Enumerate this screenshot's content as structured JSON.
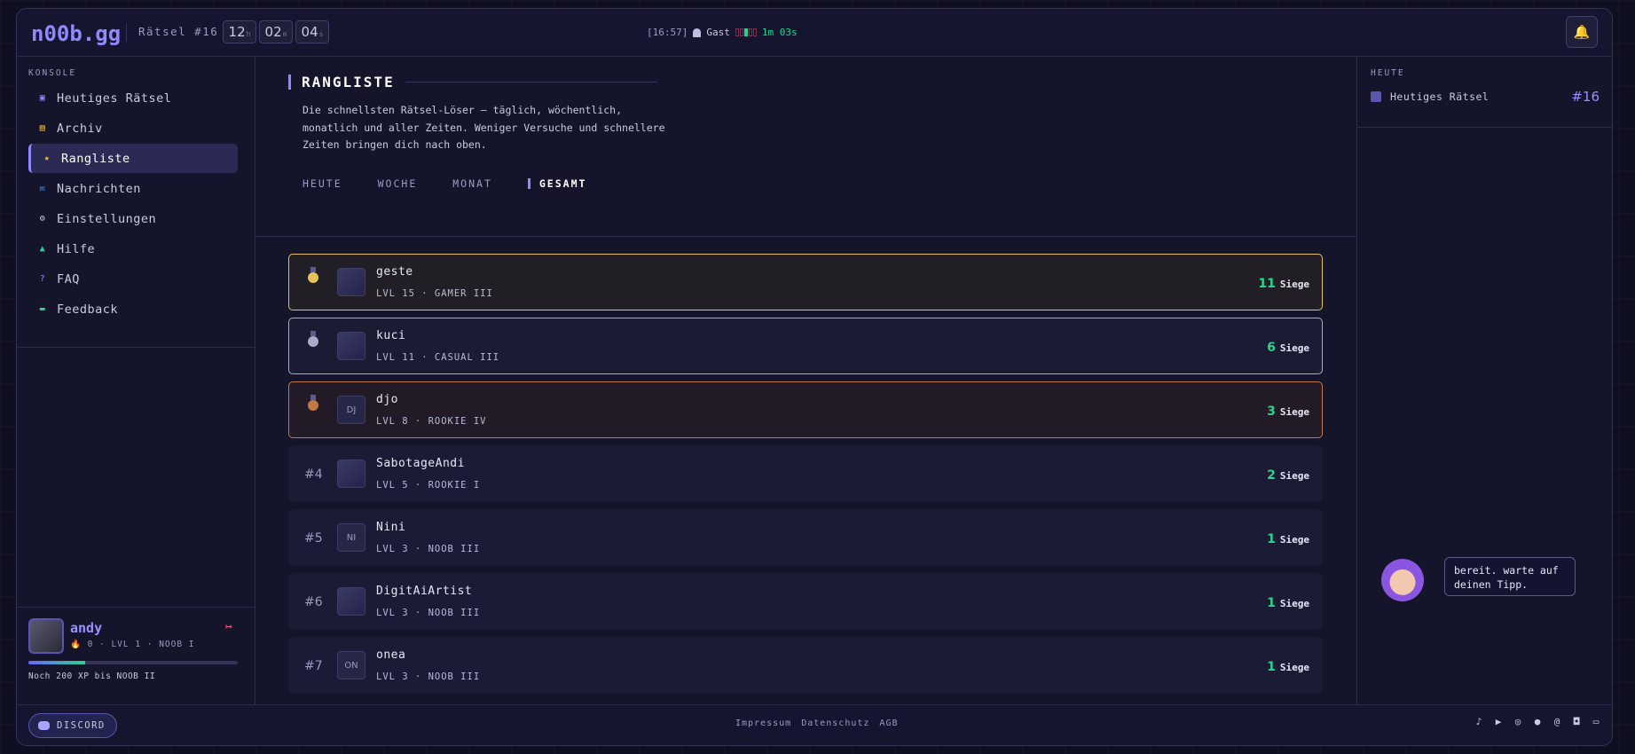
{
  "header": {
    "logo": "n00b.gg",
    "puzzle_label": "Rätsel #16",
    "timer": [
      {
        "value": "12",
        "unit": "h"
      },
      {
        "value": "02",
        "unit": "m"
      },
      {
        "value": "04",
        "unit": "s"
      }
    ],
    "clock": "[16:57]",
    "user": "Gast",
    "session": "1m 03s",
    "session_bars_total": 5,
    "session_bars_filled": 1
  },
  "sidebar": {
    "title": "KONSOLE",
    "items": [
      {
        "label": "Heutiges Rätsel",
        "icon": "puzzle-icon",
        "color": "#8f88ff"
      },
      {
        "label": "Archiv",
        "icon": "archive-icon",
        "color": "#f4c430"
      },
      {
        "label": "Rangliste",
        "icon": "trophy-icon",
        "color": "#f4c430",
        "active": true
      },
      {
        "label": "Nachrichten",
        "icon": "inbox-icon",
        "color": "#4fa3ff"
      },
      {
        "label": "Einstellungen",
        "icon": "gear-icon",
        "color": "#c9cbe0"
      },
      {
        "label": "Hilfe",
        "icon": "help-icon",
        "color": "#2bd38f"
      },
      {
        "label": "FAQ",
        "icon": "question-icon",
        "color": "#8f88ff"
      },
      {
        "label": "Feedback",
        "icon": "chat-icon",
        "color": "#2bd38f"
      }
    ]
  },
  "user": {
    "name": "andy",
    "meta": "0 · LVL 1 · NOOB I",
    "xp_progress": 0.27,
    "xp_text": "Noch 200 XP bis NOOB II"
  },
  "main": {
    "title": "RANGLISTE",
    "description": "Die schnellsten Rätsel-Löser — täglich, wöchentlich, monatlich und aller Zeiten. Weniger Versuche und schnellere Zeiten bringen dich nach oben.",
    "tabs": [
      {
        "label": "HEUTE"
      },
      {
        "label": "WOCHE"
      },
      {
        "label": "MONAT"
      },
      {
        "label": "GESAMT",
        "active": true
      }
    ],
    "wins_label": "Siege",
    "leaderboard": [
      {
        "rank": "",
        "medal": "gold",
        "name": "geste",
        "meta": "LVL 15 · GAMER III",
        "wins": "11",
        "avatar": ""
      },
      {
        "rank": "",
        "medal": "silver",
        "name": "kuci",
        "meta": "LVL 11 · CASUAL III",
        "wins": "6",
        "avatar": ""
      },
      {
        "rank": "",
        "medal": "bronze",
        "name": "djo",
        "meta": "LVL 8 · ROOKIE IV",
        "wins": "3",
        "avatar": "DJ"
      },
      {
        "rank": "#4",
        "medal": "",
        "name": "SabotageAndi",
        "meta": "LVL 5 · ROOKIE I",
        "wins": "2",
        "avatar": ""
      },
      {
        "rank": "#5",
        "medal": "",
        "name": "Nini",
        "meta": "LVL 3 · NOOB III",
        "wins": "1",
        "avatar": "NI"
      },
      {
        "rank": "#6",
        "medal": "",
        "name": "DigitAiArtist",
        "meta": "LVL 3 · NOOB III",
        "wins": "1",
        "avatar": ""
      },
      {
        "rank": "#7",
        "medal": "",
        "name": "onea",
        "meta": "LVL 3 · NOOB III",
        "wins": "1",
        "avatar": "ON"
      }
    ]
  },
  "right": {
    "title": "HEUTE",
    "item_label": "Heutiges Rätsel",
    "item_number": "#16",
    "bubble": "bereit. warte auf deinen Tipp."
  },
  "footer": {
    "discord": "DISCORD",
    "links": [
      "Impressum",
      "Datenschutz",
      "AGB"
    ],
    "socials": [
      "tiktok-icon",
      "youtube-icon",
      "instagram-icon",
      "reddit-icon",
      "threads-icon",
      "discord-icon",
      "gamepad-icon"
    ]
  },
  "colors": {
    "accent": "#8f88ff",
    "success": "#2bd38f",
    "gold": "#e8c15a",
    "silver": "#a9acc8",
    "bronze": "#c47844",
    "danger": "#ff4f7b"
  }
}
